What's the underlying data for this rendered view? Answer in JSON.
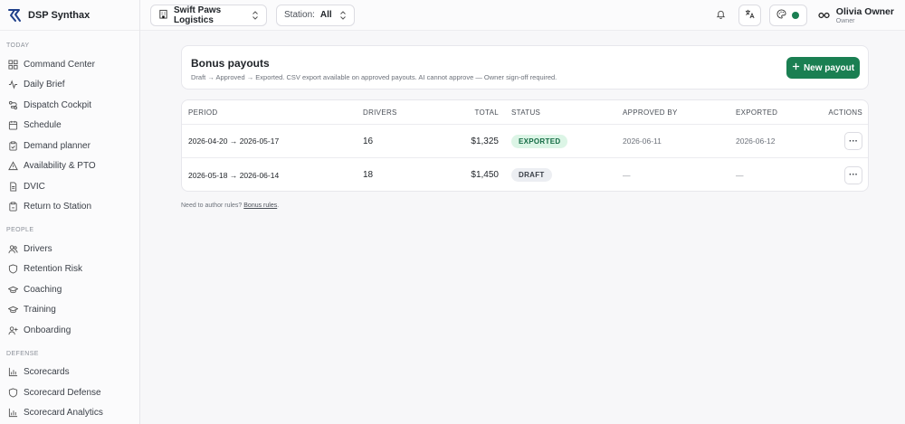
{
  "brand": {
    "name": "DSP Synthax"
  },
  "sections": {
    "today": "TODAY",
    "people": "PEOPLE",
    "defense": "DEFENSE"
  },
  "nav": {
    "today": [
      "Command Center",
      "Daily Brief",
      "Dispatch Cockpit",
      "Schedule",
      "Demand planner",
      "Availability & PTO",
      "DVIC",
      "Return to Station"
    ],
    "people": [
      "Drivers",
      "Retention Risk",
      "Coaching",
      "Training",
      "Onboarding"
    ],
    "defense": [
      "Scorecards",
      "Scorecard Defense",
      "Scorecard Analytics"
    ]
  },
  "topbar": {
    "org": "Swift Paws Logistics",
    "station_label": "Station:",
    "station_value": "All"
  },
  "user": {
    "name": "Olivia Owner",
    "role": "Owner"
  },
  "header": {
    "title": "Bonus payouts",
    "subtitle": "Draft → Approved → Exported. CSV export available on approved payouts. AI cannot approve — Owner sign-off required.",
    "new_button": "New payout"
  },
  "table": {
    "columns": [
      "PERIOD",
      "DRIVERS",
      "TOTAL",
      "STATUS",
      "APPROVED BY",
      "EXPORTED",
      "ACTIONS"
    ],
    "rows": [
      {
        "period": "2026-04-20 → 2026-05-17",
        "drivers": "16",
        "total": "$1,325",
        "status": "EXPORTED",
        "approved_by": "2026-06-11",
        "exported": "2026-06-12",
        "actions": "···"
      },
      {
        "period": "2026-05-18 → 2026-06-14",
        "drivers": "18",
        "total": "$1,450",
        "status": "DRAFT",
        "approved_by": "—",
        "exported": "—",
        "actions": "···"
      }
    ]
  },
  "footnote": {
    "text": "Need to author rules? ",
    "link": "Bonus rules",
    "end": "."
  },
  "colors": {
    "accent_green": "#1a7f52"
  }
}
